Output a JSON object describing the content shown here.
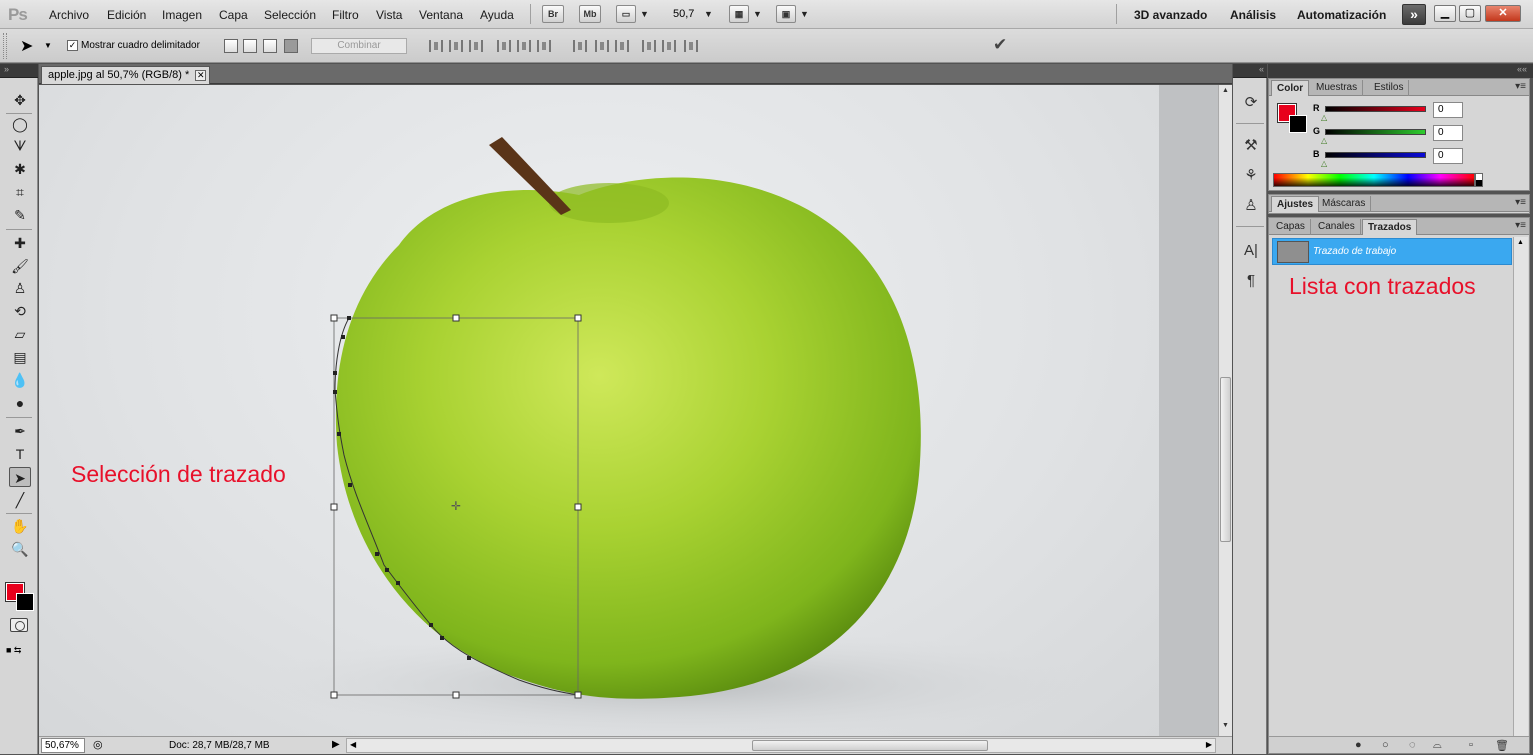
{
  "app": {
    "logo": "Ps",
    "menus": [
      "Archivo",
      "Edición",
      "Imagen",
      "Capa",
      "Selección",
      "Filtro",
      "Vista",
      "Ventana",
      "Ayuda"
    ],
    "bridge_label": "Br",
    "minibridge_label": "Mb",
    "zoom": "50,7",
    "workspaces": [
      "3D avanzado",
      "Análisis",
      "Automatización"
    ],
    "expand_label": "»"
  },
  "options": {
    "show_bbox_label": "Mostrar cuadro delimitador",
    "show_bbox_checked": true,
    "combine_label": "Combinar",
    "commit_icon": "checkmark-icon"
  },
  "document": {
    "tab_title": "apple.jpg al 50,7% (RGB/8) *",
    "tab_close": "✕",
    "status_zoom": "50,67%",
    "status_info": "Doc: 28,7 MB/28,7 MB"
  },
  "annotations": {
    "path_selection": "Selección de trazado",
    "path_list": "Lista con trazados"
  },
  "color_panel": {
    "tabs": [
      "Color",
      "Muestras",
      "Estilos"
    ],
    "active_tab": "Color",
    "channels": [
      {
        "label": "R",
        "value": "0",
        "color": "#e8001c"
      },
      {
        "label": "G",
        "value": "0",
        "color": "#2fcc2f"
      },
      {
        "label": "B",
        "value": "0",
        "color": "#0b0bd8"
      }
    ],
    "foreground": "#e8001c",
    "background": "#000000"
  },
  "adjust_panel": {
    "tabs": [
      "Ajustes",
      "Máscaras"
    ]
  },
  "paths_panel": {
    "tabs": [
      "Capas",
      "Canales",
      "Trazados"
    ],
    "active_tab": "Trazados",
    "paths": [
      {
        "name": "Trazado de trabajo",
        "selected": true
      }
    ]
  }
}
